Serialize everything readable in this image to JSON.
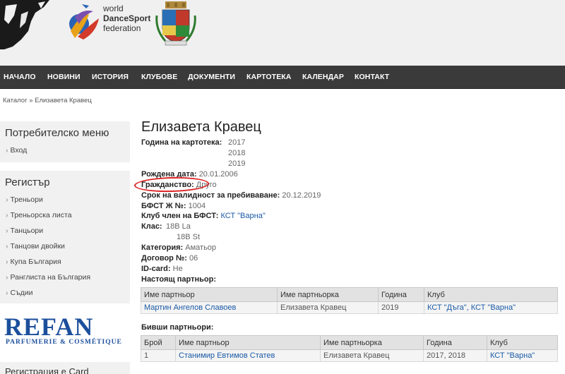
{
  "header": {
    "wdsf_line1": "world",
    "wdsf_line2": "DanceSport",
    "wdsf_line3": "federation"
  },
  "nav": [
    "НАЧАЛО",
    "НОВИНИ",
    "ИСТОРИЯ",
    "КЛУБОВЕ",
    "ДОКУМЕНТИ",
    "КАРТОТЕКА",
    "КАЛЕНДАР",
    "КОНТАКТ"
  ],
  "breadcrumb": {
    "catalog": "Каталог",
    "sep": "»",
    "current": "Елизавета Кравец"
  },
  "sidebar": {
    "user_menu": {
      "title": "Потребителско меню",
      "items": [
        "Вход"
      ]
    },
    "register": {
      "title": "Регистър",
      "items": [
        "Треньори",
        "Треньорска листа",
        "Танцьори",
        "Танцови двойки",
        "Купа България",
        "Ранглиста на България",
        "Съдии"
      ]
    },
    "ad": {
      "brand": "REFAN",
      "tagline": "PARFUMERIE & COSMÉTIQUE"
    },
    "card_title": "Регистрация е Card"
  },
  "profile": {
    "name": "Елизавета Кравец",
    "year_label": "Година на картотека:",
    "years": [
      "2017",
      "2018",
      "2019"
    ],
    "birth_label": "Рождена дата:",
    "birth": "20.01.2006",
    "citizenship_label": "Гражданство:",
    "citizenship": "Друго",
    "validity_label": "Срок на валидност за пребиваване:",
    "validity": "20.12.2019",
    "bfst_label": "БФСТ Ж №:",
    "bfst": "1004",
    "club_label": "Клуб член на БФСТ:",
    "club": "КСТ \"Варна\"",
    "class_label": "Клас:",
    "classes": [
      "18B La",
      "18B St"
    ],
    "category_label": "Категория:",
    "category": "Аматьор",
    "contract_label": "Договор №:",
    "contract": "06",
    "idcard_label": "ID-card:",
    "idcard": "Не"
  },
  "current_partner": {
    "title": "Настоящ партньор:",
    "headers": [
      "Име партньор",
      "Име партньорка",
      "Година",
      "Клуб"
    ],
    "rows": [
      [
        "Мартин Ангелов Славоев",
        "Елизавета Кравец",
        "2019",
        "КСТ \"Дъга\", КСТ \"Варна\""
      ]
    ]
  },
  "former_partners": {
    "title": "Бивши партньори:",
    "headers": [
      "Брой",
      "Име партньор",
      "Име партньорка",
      "Година",
      "Клуб"
    ],
    "rows": [
      [
        "1",
        "Станимир Евтимов Статев",
        "Елизавета Кравец",
        "2017, 2018",
        "КСТ \"Варна\""
      ]
    ]
  },
  "colors": {
    "nav_bg": "#3a3a3a",
    "link": "#1a5aa6",
    "highlight_circle": "#dd2222",
    "refan_blue": "#1c4f9c"
  }
}
